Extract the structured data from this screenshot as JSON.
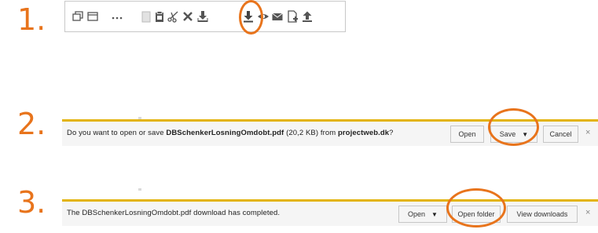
{
  "steps": {
    "step1": "1.",
    "step2": "2.",
    "step3": "3."
  },
  "toolbar": {
    "icons": [
      "restore-icon",
      "window-icon",
      "more-icon",
      "clipboard-icon",
      "paste-icon",
      "scissors-icon",
      "delete-icon",
      "download-alt-icon",
      "download-icon",
      "eye-icon",
      "mail-icon",
      "file-add-icon",
      "upload-icon"
    ]
  },
  "prompt_bar": {
    "text_before": "Do you want to open or save ",
    "filename": "DBSchenkerLosningOmdobt.pdf",
    "text_middle": " (20,2 KB) from ",
    "site": "projectweb.dk",
    "text_after": "?",
    "open_label": "Open",
    "save_label": "Save",
    "save_caret": "▼",
    "cancel_label": "Cancel",
    "close_label": "×"
  },
  "complete_bar": {
    "text": "The DBSchenkerLosningOmdobt.pdf download has completed.",
    "open_label": "Open",
    "open_caret": "▼",
    "open_folder_label": "Open folder",
    "view_downloads_label": "View downloads",
    "close_label": "×"
  },
  "colors": {
    "accent": "#e8741c",
    "bar_border": "#e3b40d",
    "bar_bg": "#f5f5f5"
  }
}
